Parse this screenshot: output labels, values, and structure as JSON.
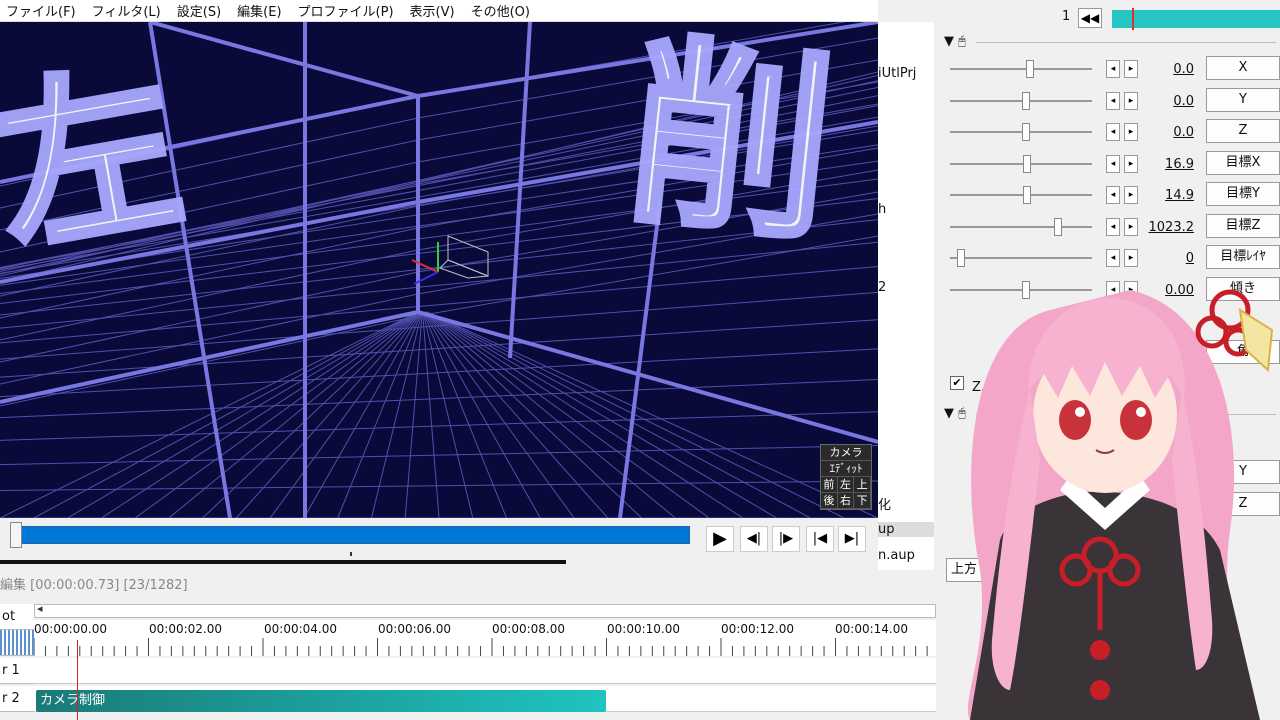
{
  "menu": [
    "ファイル(F)",
    "フィルタ(L)",
    "設定(S)",
    "編集(E)",
    "プロファイル(P)",
    "表示(V)",
    "その他(O)"
  ],
  "viewport": {
    "text_left": "左",
    "text_right": "削",
    "camera_panel": {
      "camera": "カメラ",
      "edit": "ｴﾃﾞｨｯﾄ",
      "grid": [
        "前",
        "左",
        "上",
        "後",
        "右",
        "下"
      ]
    }
  },
  "seekbar": {
    "play": "▶",
    "prev_frame": "◀|",
    "next_frame": "|▶",
    "to_start": "|◀",
    "to_end": "▶|"
  },
  "side_list": {
    "entries": [
      "iUtlPrj",
      "h",
      "2",
      "化",
      "up",
      "n.aup"
    ]
  },
  "timeline": {
    "status": "編集 [00:00:00.73] [23/1282]",
    "scroll_left": "◂",
    "ruler": [
      "00:00:00.00",
      "00:00:02.00",
      "00:00:04.00",
      "00:00:06.00",
      "00:00:08.00",
      "00:00:10.00",
      "00:00:12.00",
      "00:00:14.00"
    ],
    "layers": [
      "ot",
      "",
      "r 1",
      "r 2"
    ],
    "clip_label": "カメラ制御"
  },
  "settings": {
    "frame_number": "1",
    "frame_button": "◀◀",
    "group1": "▼ 🖰",
    "group2": "▼ 🖰",
    "params": [
      {
        "value": "0.0",
        "button": "X",
        "thumb": 0.55
      },
      {
        "value": "0.0",
        "button": "Y",
        "thumb": 0.52
      },
      {
        "value": "0.0",
        "button": "Z",
        "thumb": 0.52
      },
      {
        "value": "16.9",
        "button": "目標X",
        "thumb": 0.53
      },
      {
        "value": "14.9",
        "button": "目標Y",
        "thumb": 0.53
      },
      {
        "value": "1023.2",
        "button": "目標Z",
        "thumb": 0.75
      },
      {
        "value": "0",
        "button": "目標ﾚｲﾔ",
        "thumb": 0.05
      },
      {
        "value": "0.00",
        "button": "傾き",
        "thumb": 0.52
      }
    ],
    "arrow_left": "◂",
    "arrow_right": "▸",
    "checkbox": "✔",
    "checkbox_label": "Zバッフ",
    "partial_button_1": "角",
    "partial_button_2": "Y",
    "partial_button_3": "Z",
    "dropdown_partial": "上方"
  },
  "colors": {
    "viewport_bg": "#0a0a3a",
    "grid_line": "#7070d0",
    "seek_blue": "#0078d7",
    "clip_teal": "#1fc4c0",
    "hair_pink": "#f4a6c8"
  }
}
